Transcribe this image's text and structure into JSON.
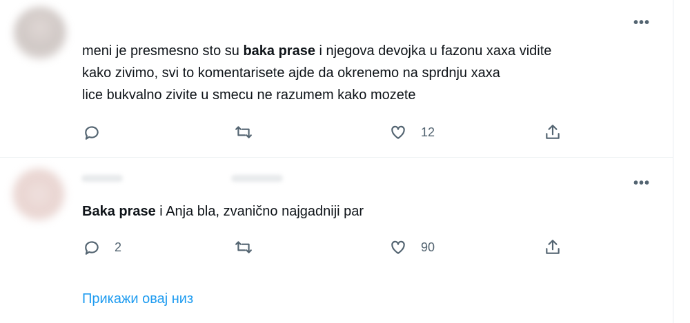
{
  "tweets": [
    {
      "text_pre": "meni je presmesno sto su ",
      "text_bold": "baka prase",
      "text_line1_post": " i njegova devojka u fazonu xaxa vidite",
      "text_line2": "kako zivimo, svi to komentarisete ajde da okrenemo na sprdnju xaxa",
      "text_line3": "lice bukvalno zivite u smecu ne razumem kako mozete",
      "reply_count": "",
      "retweet_count": "",
      "like_count": "12"
    },
    {
      "text_bold": "Baka prase",
      "text_post": " i Anja bla, zvanično najgadniji par",
      "reply_count": "2",
      "retweet_count": "",
      "like_count": "90"
    }
  ],
  "more_label": "•••",
  "show_thread": "Прикажи овај низ",
  "icons": {
    "reply": "reply-icon",
    "retweet": "retweet-icon",
    "like": "heart-icon",
    "share": "share-icon",
    "more": "more-icon"
  },
  "colors": {
    "link": "#1d9bf0",
    "icon": "#536471",
    "text": "#0f1419"
  }
}
